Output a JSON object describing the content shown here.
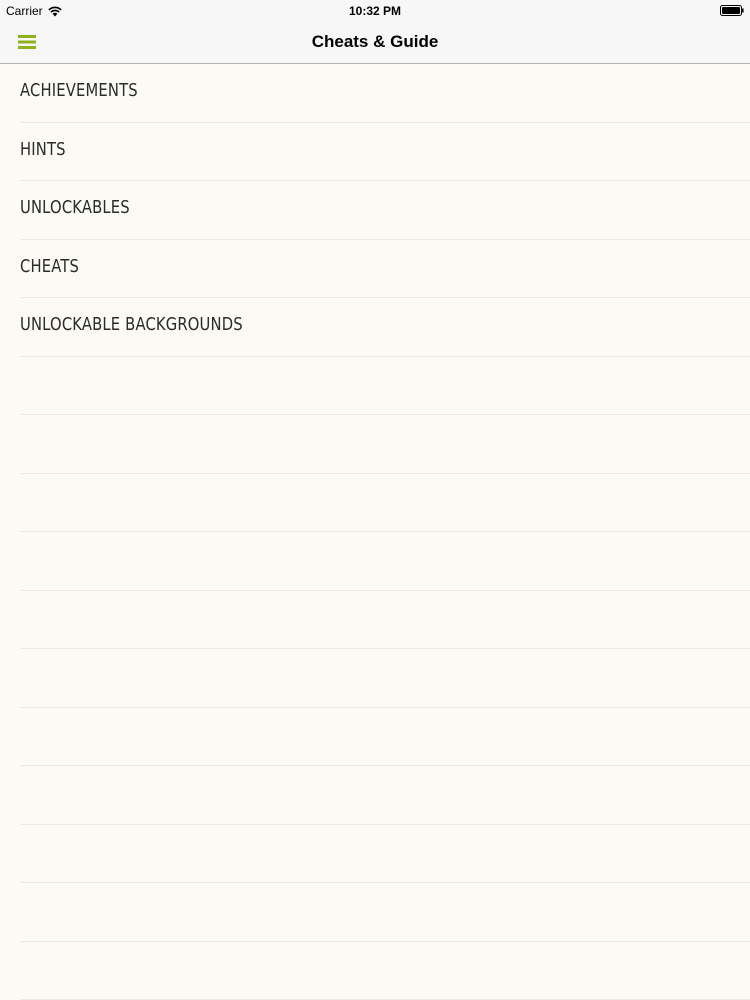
{
  "status_bar": {
    "carrier": "Carrier",
    "time": "10:32 PM",
    "wifi_icon": "wifi-icon",
    "battery_icon": "battery-icon"
  },
  "nav_bar": {
    "title": "Cheats & Guide",
    "menu_icon": "hamburger-menu-icon",
    "accent_color": "#8cb31b"
  },
  "menu": {
    "items": [
      {
        "label": "ACHIEVEMENTS"
      },
      {
        "label": "HINTS"
      },
      {
        "label": "UNLOCKABLES"
      },
      {
        "label": "CHEATS"
      },
      {
        "label": "UNLOCKABLE BACKGROUNDS"
      }
    ]
  },
  "colors": {
    "background": "#fbfaf4",
    "separator": "#e9e8e1",
    "text": "#2b2b2b"
  }
}
